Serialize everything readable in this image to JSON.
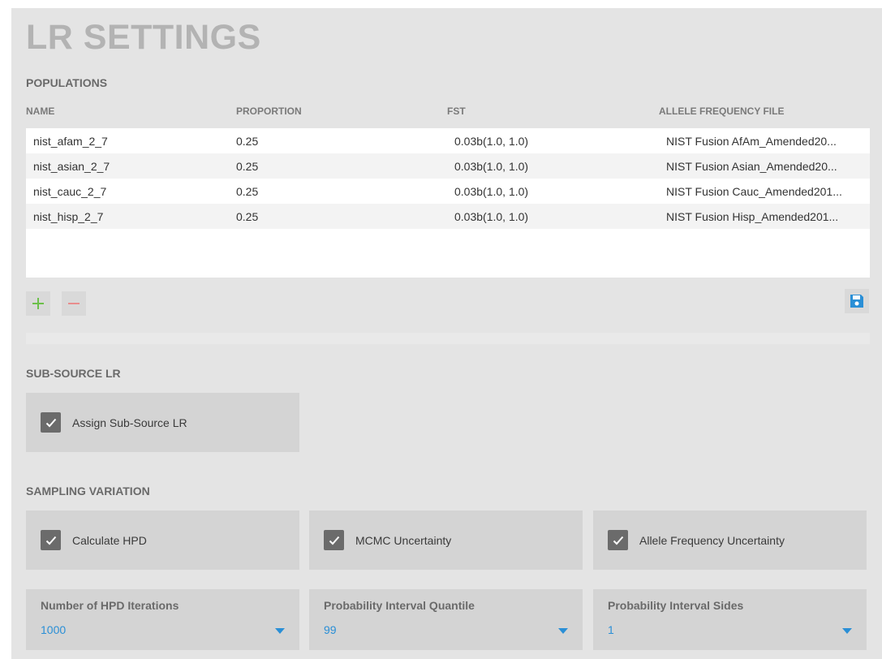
{
  "title": "LR SETTINGS",
  "populations": {
    "heading": "POPULATIONS",
    "columns": [
      "NAME",
      "PROPORTION",
      "FST",
      "ALLELE FREQUENCY FILE"
    ],
    "rows": [
      [
        "nist_afam_2_7",
        "0.25",
        "0.03b(1.0, 1.0)",
        "NIST Fusion AfAm_Amended20..."
      ],
      [
        "nist_asian_2_7",
        "0.25",
        "0.03b(1.0, 1.0)",
        "NIST Fusion Asian_Amended20..."
      ],
      [
        "nist_cauc_2_7",
        "0.25",
        "0.03b(1.0, 1.0)",
        "NIST Fusion Cauc_Amended201..."
      ],
      [
        "nist_hisp_2_7",
        "0.25",
        "0.03b(1.0, 1.0)",
        "NIST Fusion Hisp_Amended201..."
      ]
    ]
  },
  "sub_source": {
    "heading": "SUB-SOURCE LR",
    "checkbox_label": "Assign Sub-Source LR",
    "checked": true
  },
  "sampling": {
    "heading": "SAMPLING VARIATION",
    "checkboxes": [
      {
        "label": "Calculate HPD",
        "checked": true
      },
      {
        "label": "MCMC Uncertainty",
        "checked": true
      },
      {
        "label": "Allele Frequency Uncertainty",
        "checked": true
      }
    ],
    "dropdowns": [
      {
        "label": "Number of HPD Iterations",
        "value": "1000"
      },
      {
        "label": "Probability Interval Quantile",
        "value": "99"
      },
      {
        "label": "Probability Interval Sides",
        "value": "1"
      }
    ]
  },
  "icons": {
    "add": "plus-icon",
    "remove": "minus-icon",
    "save": "save-icon",
    "check": "check-icon",
    "dropdown": "caret-down-icon"
  },
  "colors": {
    "add": "#6cc04a",
    "remove": "#e88d8d",
    "save": "#2a8fd6",
    "dropdown_value": "#2a8fd6"
  }
}
